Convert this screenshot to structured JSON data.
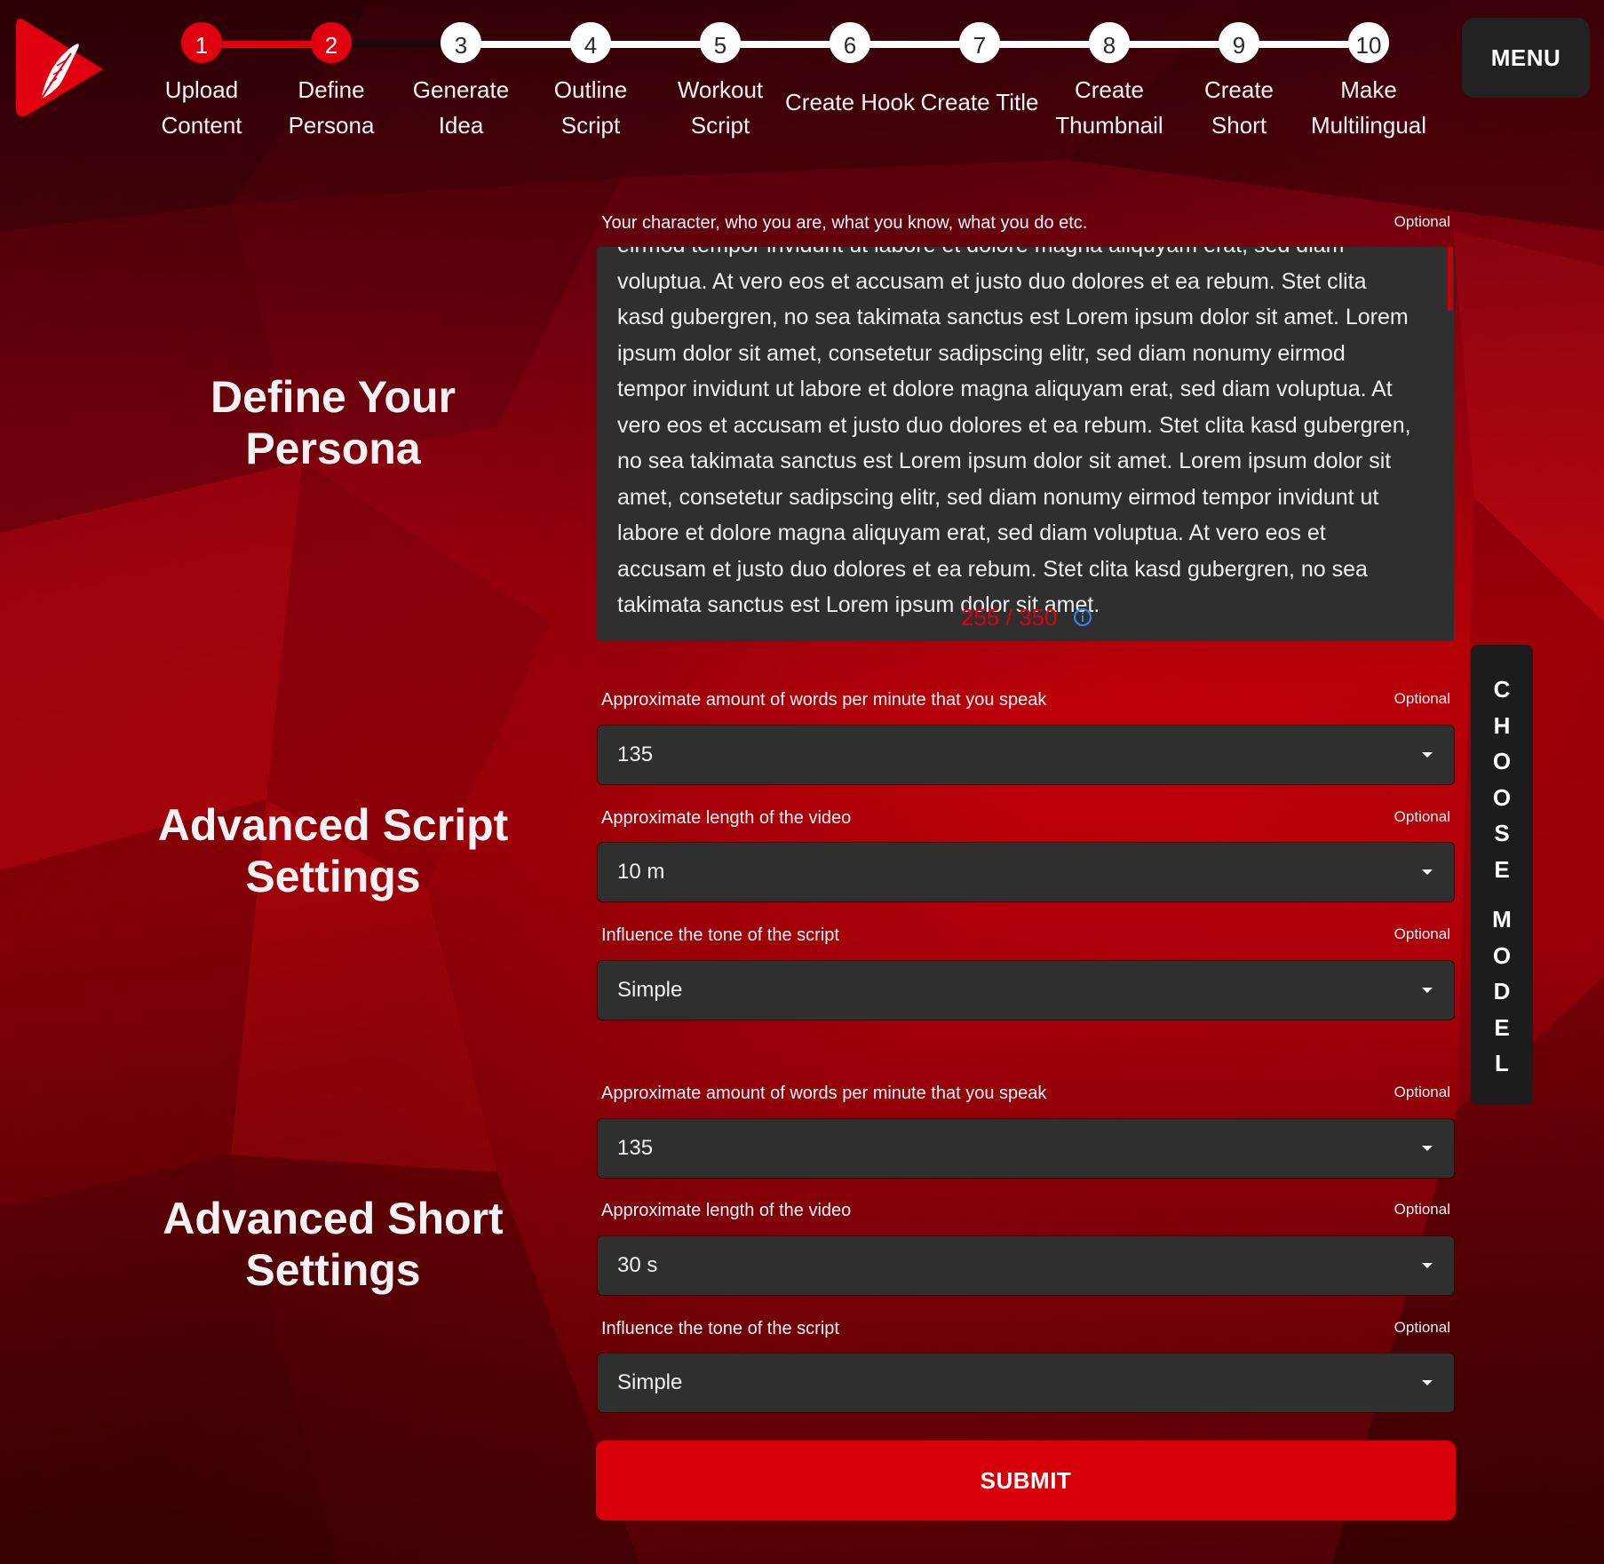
{
  "steps": [
    {
      "number": "1",
      "line1": "Upload",
      "line2": "Content"
    },
    {
      "number": "2",
      "line1": "Define",
      "line2": "Persona"
    },
    {
      "number": "3",
      "line1": "Generate",
      "line2": "Idea"
    },
    {
      "number": "4",
      "line1": "Outline",
      "line2": "Script"
    },
    {
      "number": "5",
      "line1": "Workout",
      "line2": "Script"
    },
    {
      "number": "6",
      "line1": "Create Hook",
      "line2": ""
    },
    {
      "number": "7",
      "line1": "Create Title",
      "line2": ""
    },
    {
      "number": "8",
      "line1": "Create",
      "line2": "Thumbnail"
    },
    {
      "number": "9",
      "line1": "Create",
      "line2": "Short"
    },
    {
      "number": "10",
      "line1": "Make",
      "line2": "Multilingual"
    }
  ],
  "menu_label": "MENU",
  "sections": {
    "persona_title": "Define Your Persona",
    "script_title": "Advanced Script Settings",
    "short_title": "Advanced Short Settings"
  },
  "persona": {
    "label": "Your character, who you are, what you know, what you do etc.",
    "optional": "Optional",
    "text": "eirmod tempor invidunt ut labore et dolore magna aliquyam erat, sed diam voluptua. At vero eos et accusam et justo duo dolores et ea rebum. Stet clita kasd gubergren, no sea takimata sanctus est Lorem ipsum dolor sit amet. Lorem ipsum dolor sit amet, consetetur sadipscing elitr, sed diam nonumy eirmod tempor invidunt ut labore et dolore magna aliquyam erat, sed diam voluptua. At vero eos et accusam et justo duo dolores et ea rebum. Stet clita kasd gubergren, no sea takimata sanctus est Lorem ipsum dolor sit amet. Lorem ipsum dolor sit amet, consetetur sadipscing elitr, sed diam nonumy eirmod tempor invidunt ut labore et dolore magna aliquyam erat, sed diam voluptua. At vero eos et accusam et justo duo dolores et ea rebum. Stet clita kasd gubergren, no sea takimata sanctus est Lorem ipsum dolor sit amet.",
    "counter": "255 / 350"
  },
  "script_settings": {
    "wpm_label": "Approximate amount of words per minute that you speak",
    "wpm_value": "135",
    "length_label": "Approximate length of the video",
    "length_value": "10 m",
    "tone_label": "Influence the tone of the script",
    "tone_value": "Simple",
    "optional": "Optional"
  },
  "short_settings": {
    "wpm_label": "Approximate amount of words per minute that you speak",
    "wpm_value": "135",
    "length_label": "Approximate length of the video",
    "length_value": "30 s",
    "tone_label": "Influence the tone of the script",
    "tone_value": "Simple",
    "optional": "Optional"
  },
  "submit_label": "SUBMIT",
  "choose_model_word1": "CHOOSE",
  "choose_model_word2": "MODEL",
  "colors": {
    "accent": "#e10010",
    "panel": "#2f2f2f",
    "menu": "#222222"
  }
}
